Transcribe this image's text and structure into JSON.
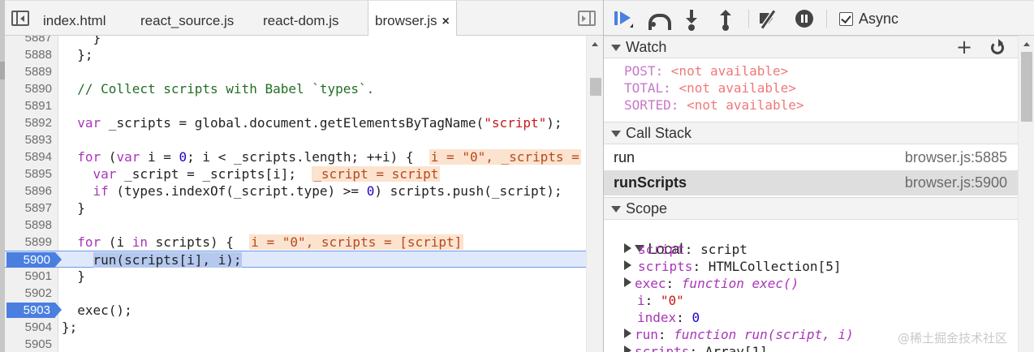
{
  "tabs": [
    "index.html",
    "react_source.js",
    "react-dom.js",
    "browser.js"
  ],
  "active_tab_close": "×",
  "editor": {
    "lines": [
      {
        "n": "5887",
        "code": "    }"
      },
      {
        "n": "5888",
        "code": "  };"
      },
      {
        "n": "5889",
        "code": ""
      },
      {
        "n": "5890",
        "code": "  // Collect scripts with Babel `types`."
      },
      {
        "n": "5891",
        "code": ""
      },
      {
        "n": "5892",
        "code": "  var _scripts = global.document.getElementsByTagName(\"script\");"
      },
      {
        "n": "5893",
        "code": ""
      },
      {
        "n": "5894",
        "code": "  for (var i = 0; i < _scripts.length; ++i) {  i = \"0\", _scripts ="
      },
      {
        "n": "5895",
        "code": "    var _script = _scripts[i];  _script = script"
      },
      {
        "n": "5896",
        "code": "    if (types.indexOf(_script.type) >= 0) scripts.push(_script);"
      },
      {
        "n": "5897",
        "code": "  }"
      },
      {
        "n": "5898",
        "code": ""
      },
      {
        "n": "5899",
        "code": "  for (i in scripts) {  i = \"0\", scripts = [script]"
      },
      {
        "n": "5900",
        "code": "    run(scripts[i], i);"
      },
      {
        "n": "5901",
        "code": "  }"
      },
      {
        "n": "5902",
        "code": ""
      },
      {
        "n": "5903",
        "code": "  exec();"
      },
      {
        "n": "5904",
        "code": "};"
      },
      {
        "n": "5905",
        "code": ""
      }
    ],
    "exec_line": "5900",
    "breakpoint_lines": [
      "5900",
      "5903"
    ]
  },
  "toolbar": {
    "async_label": "Async",
    "async_checked": true
  },
  "watch": {
    "title": "Watch",
    "items": [
      {
        "key": "POST",
        "value": "<not available>"
      },
      {
        "key": "TOTAL",
        "value": "<not available>"
      },
      {
        "key": "SORTED",
        "value": "<not available>"
      }
    ]
  },
  "call_stack": {
    "title": "Call Stack",
    "frames": [
      {
        "fn": "run",
        "loc": "browser.js:5885",
        "selected": false
      },
      {
        "fn": "runScripts",
        "loc": "browser.js:5900",
        "selected": true
      }
    ]
  },
  "scope": {
    "title": "Scope",
    "local_label": "Local",
    "vars": [
      {
        "key": "script",
        "value": "script",
        "kind": "obj",
        "expandable": true
      },
      {
        "key": "scripts",
        "value": "HTMLCollection[5]",
        "kind": "obj",
        "expandable": true
      },
      {
        "key": "exec",
        "value": "exec()",
        "prefix": "function ",
        "kind": "fn",
        "expandable": true
      },
      {
        "key": "i",
        "value": "\"0\"",
        "kind": "str",
        "expandable": false
      },
      {
        "key": "index",
        "value": "0",
        "kind": "num",
        "expandable": false
      },
      {
        "key": "run",
        "value": "run(script, i)",
        "prefix": "function ",
        "kind": "fn",
        "expandable": true
      },
      {
        "key": "scripts",
        "value": "Array[1]",
        "kind": "obj",
        "expandable": true
      }
    ]
  },
  "watermark": "@稀土掘金技术社区"
}
